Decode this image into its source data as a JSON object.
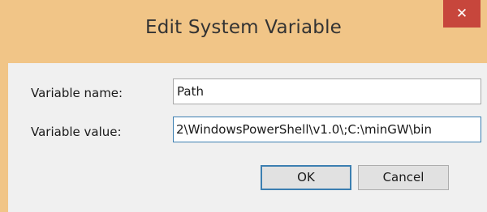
{
  "window": {
    "title": "Edit System Variable",
    "close_label": "✕"
  },
  "form": {
    "name_label": "Variable name:",
    "name_value": "Path",
    "value_label": "Variable value:",
    "value_value": "2\\WindowsPowerShell\\v1.0\\;C:\\minGW\\bin"
  },
  "buttons": {
    "ok_label": "OK",
    "cancel_label": "Cancel"
  },
  "colors": {
    "titlebar": "#f1c587",
    "close": "#c7463c",
    "focus_border": "#3c7fb1"
  },
  "icons": {
    "close": "close-icon"
  }
}
